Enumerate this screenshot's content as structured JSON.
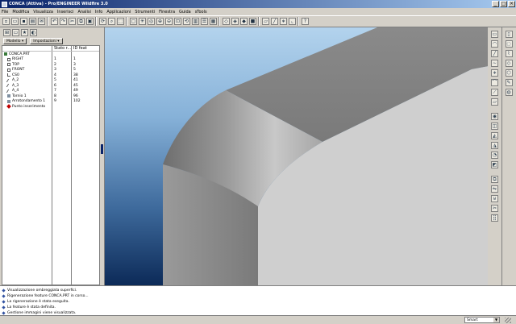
{
  "window": {
    "title": "CONCA (Attiva) - Pro/ENGINEER Wildfire 3.0",
    "controls": [
      "_",
      "□",
      "×"
    ]
  },
  "menu": [
    "File",
    "Modifica",
    "Visualizza",
    "Inserisci",
    "Analisi",
    "Info",
    "Applicazioni",
    "Strumenti",
    "Finestra",
    "Guida",
    "sTools"
  ],
  "left_panel": {
    "tab_model": "Modello ▾",
    "tab_settings": "Impostazioni ▾",
    "columns": [
      "",
      "Stato r...",
      "ID feat"
    ],
    "rows": [
      {
        "name": "CONCA.PRT",
        "icon": "part",
        "status": "",
        "id": ""
      },
      {
        "name": "RIGHT",
        "icon": "plane",
        "status": "1",
        "id": "1"
      },
      {
        "name": "TOP",
        "icon": "plane",
        "status": "2",
        "id": "3"
      },
      {
        "name": "FRONT",
        "icon": "plane",
        "status": "3",
        "id": "5"
      },
      {
        "name": "CS0",
        "icon": "csys",
        "status": "4",
        "id": "38"
      },
      {
        "name": "A_2",
        "icon": "axis",
        "status": "5",
        "id": "41"
      },
      {
        "name": "A_3",
        "icon": "axis",
        "status": "6",
        "id": "45"
      },
      {
        "name": "A_4",
        "icon": "axis",
        "status": "7",
        "id": "49"
      },
      {
        "name": "Tornio 1",
        "icon": "feat",
        "status": "8",
        "id": "96"
      },
      {
        "name": "Arrotondamento 1",
        "icon": "feat",
        "status": "9",
        "id": "102"
      },
      {
        "name": "Punto inserimento",
        "icon": "insert",
        "status": "",
        "id": ""
      }
    ]
  },
  "messages": [
    "Visualizzazione ombreggiata superfici.",
    "Rigenerazione feature CONCA.PRT in corso...",
    "La rigenerazione è stata eseguita.",
    "La feature è stata definita.",
    "Gestione immagini viene visualizzata."
  ],
  "status": {
    "filter_value": "Smart"
  },
  "colors": {
    "title_start": "#0a246a",
    "viewport_top": "#b3d3ed",
    "viewport_bottom": "#0c2a58",
    "model_light": "#cfcfcf",
    "model_dark": "#7c7c7c"
  }
}
